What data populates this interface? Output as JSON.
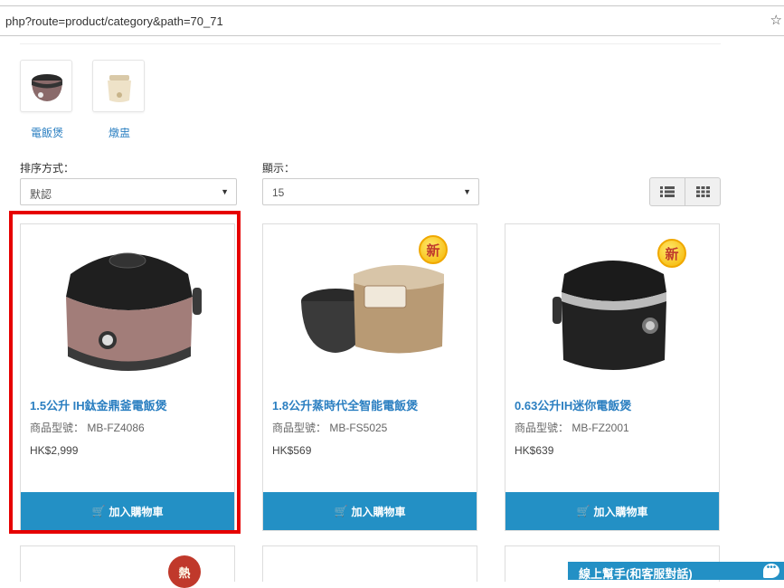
{
  "browser": {
    "url": "php?route=product/category&path=70_71",
    "bookmark_icon": "star-icon"
  },
  "categories": [
    {
      "label": "電飯煲",
      "icon": "rice-cooker-thumbnail"
    },
    {
      "label": "燉盅",
      "icon": "slow-cooker-thumbnail"
    }
  ],
  "sort": {
    "label": "排序方式：",
    "value": "默認"
  },
  "limit": {
    "label": "顯示：",
    "value": "15"
  },
  "view_toggle": {
    "list_icon": "list-view-icon",
    "grid_icon": "grid-view-icon"
  },
  "products": [
    {
      "name": "1.5公升 IH鈦金鼎釜電飯煲",
      "model": "商品型號： MB-FZ4086",
      "price": "HK$2,999",
      "new": false
    },
    {
      "name": "1.8公升蒸時代全智能電飯煲",
      "model": "商品型號： MB-FS5025",
      "price": "HK$569",
      "new": true,
      "badge": "新"
    },
    {
      "name": "0.63公升IH迷你電飯煲",
      "model": "商品型號： MB-FZ2001",
      "price": "HK$639",
      "new": true,
      "badge": "新"
    }
  ],
  "cart_label": "加入購物車",
  "row2_badge": "熱",
  "livechat": {
    "label": "線上幫手(和客服對話)"
  },
  "colors": {
    "accent": "#2390c5",
    "link": "#2b7fc1",
    "highlight": "#e60000"
  }
}
